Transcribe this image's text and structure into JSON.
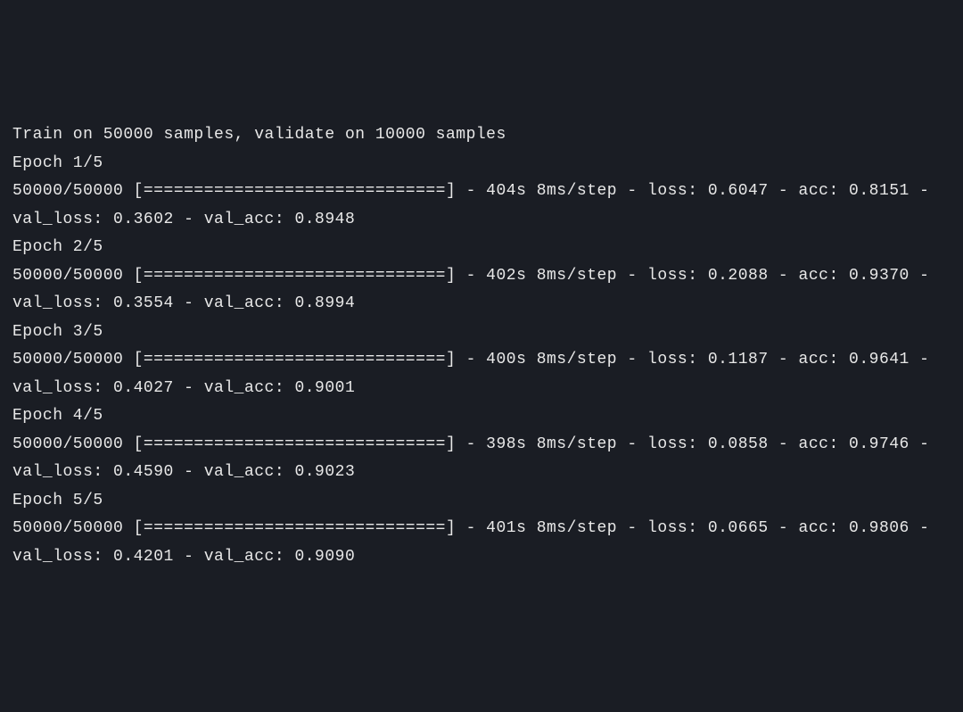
{
  "training": {
    "header": "Train on 50000 samples, validate on 10000 samples",
    "train_samples": 50000,
    "validate_samples": 10000,
    "total_epochs": 5,
    "epochs": [
      {
        "index": 1,
        "label": "Epoch 1/5",
        "progress_line": "50000/50000 [==============================] - 404s 8ms/step - loss: 0.6047 - acc: 0.8151 - val_loss: 0.3602 - val_acc: 0.8948",
        "current": 50000,
        "total": 50000,
        "bar": "[==============================]",
        "time_s": 404,
        "per_step": "8ms/step",
        "loss": 0.6047,
        "acc": 0.8151,
        "val_loss": 0.3602,
        "val_acc": 0.8948
      },
      {
        "index": 2,
        "label": "Epoch 2/5",
        "progress_line": "50000/50000 [==============================] - 402s 8ms/step - loss: 0.2088 - acc: 0.9370 - val_loss: 0.3554 - val_acc: 0.8994",
        "current": 50000,
        "total": 50000,
        "bar": "[==============================]",
        "time_s": 402,
        "per_step": "8ms/step",
        "loss": 0.2088,
        "acc": 0.937,
        "val_loss": 0.3554,
        "val_acc": 0.8994
      },
      {
        "index": 3,
        "label": "Epoch 3/5",
        "progress_line": "50000/50000 [==============================] - 400s 8ms/step - loss: 0.1187 - acc: 0.9641 - val_loss: 0.4027 - val_acc: 0.9001",
        "current": 50000,
        "total": 50000,
        "bar": "[==============================]",
        "time_s": 400,
        "per_step": "8ms/step",
        "loss": 0.1187,
        "acc": 0.9641,
        "val_loss": 0.4027,
        "val_acc": 0.9001
      },
      {
        "index": 4,
        "label": "Epoch 4/5",
        "progress_line": "50000/50000 [==============================] - 398s 8ms/step - loss: 0.0858 - acc: 0.9746 - val_loss: 0.4590 - val_acc: 0.9023",
        "current": 50000,
        "total": 50000,
        "bar": "[==============================]",
        "time_s": 398,
        "per_step": "8ms/step",
        "loss": 0.0858,
        "acc": 0.9746,
        "val_loss": 0.459,
        "val_acc": 0.9023
      },
      {
        "index": 5,
        "label": "Epoch 5/5",
        "progress_line": "50000/50000 [==============================] - 401s 8ms/step - loss: 0.0665 - acc: 0.9806 - val_loss: 0.4201 - val_acc: 0.9090",
        "current": 50000,
        "total": 50000,
        "bar": "[==============================]",
        "time_s": 401,
        "per_step": "8ms/step",
        "loss": 0.0665,
        "acc": 0.9806,
        "val_loss": 0.4201,
        "val_acc": 0.909
      }
    ]
  }
}
